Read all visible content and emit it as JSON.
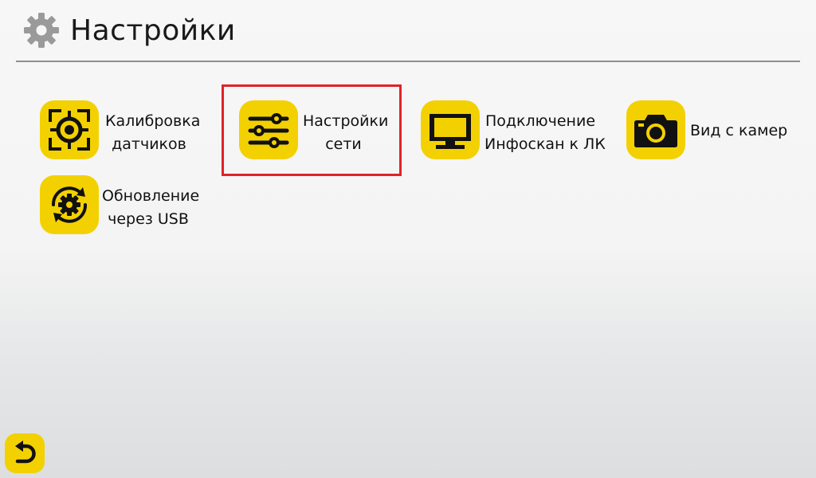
{
  "header": {
    "title": "Настройки",
    "icon": "gear-icon"
  },
  "colors": {
    "accent": "#f3d100",
    "selection": "#e0222a",
    "divider": "#8f8f8f"
  },
  "menu": {
    "items": [
      {
        "icon": "target-icon",
        "line1": "Калибровка",
        "line2": "датчиков"
      },
      {
        "icon": "sliders-icon",
        "line1": "Настройки",
        "line2": "сети",
        "selected": true
      },
      {
        "icon": "monitor-icon",
        "line1": "Подключение",
        "line2": "Инфоскан к ЛК"
      },
      {
        "icon": "camera-icon",
        "line1": "Вид с камер",
        "line2": ""
      },
      {
        "icon": "gear-refresh-icon",
        "line1": "Обновление",
        "line2": "через USB"
      }
    ]
  },
  "footer": {
    "back_icon": "back-arrow-icon"
  }
}
